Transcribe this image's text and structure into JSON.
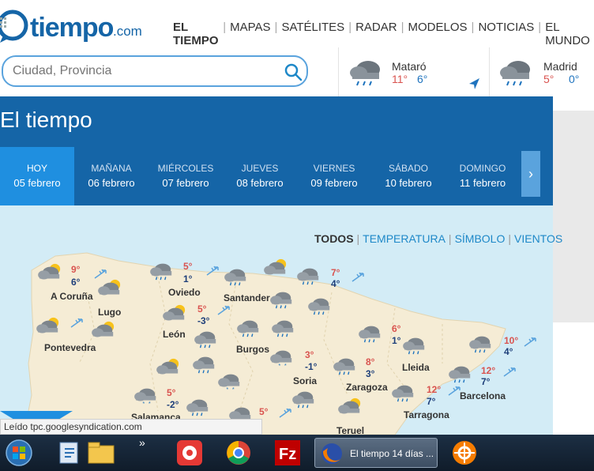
{
  "logo": {
    "brand": "tiempo",
    "domain": ".com"
  },
  "nav": {
    "items": [
      "EL TIEMPO",
      "MAPAS",
      "SATÉLITES",
      "RADAR",
      "MODELOS",
      "NOTICIAS",
      "EL MUNDO"
    ]
  },
  "search": {
    "placeholder": "Ciudad, Provincia"
  },
  "saved_locations": [
    {
      "name": "Mataró",
      "max": "11°",
      "min": "6°",
      "icon": "rain-cloud-icon"
    },
    {
      "name": "Madrid",
      "max": "5°",
      "min": "0°",
      "icon": "rain-cloud-icon"
    }
  ],
  "main": {
    "title": "El tiempo"
  },
  "days": [
    {
      "name": "HOY",
      "date": "05 febrero"
    },
    {
      "name": "MAÑANA",
      "date": "06 febrero"
    },
    {
      "name": "MIÉRCOLES",
      "date": "07 febrero"
    },
    {
      "name": "JUEVES",
      "date": "08 febrero"
    },
    {
      "name": "VIERNES",
      "date": "09 febrero"
    },
    {
      "name": "SÁBADO",
      "date": "10 febrero"
    },
    {
      "name": "DOMINGO",
      "date": "11 febrero"
    }
  ],
  "filters": {
    "all": "TODOS",
    "temperature": "TEMPERATURA",
    "symbol": "SÍMBOLO",
    "winds": "VIENTOS"
  },
  "map_cities": [
    {
      "name": "A Coruña",
      "max": "9°",
      "min": "6°"
    },
    {
      "name": "Lugo",
      "max": "",
      "min": ""
    },
    {
      "name": "Oviedo",
      "max": "5°",
      "min": "1°"
    },
    {
      "name": "Santander",
      "max": "",
      "min": ""
    },
    {
      "name": "León",
      "max": "5°",
      "min": "-3°"
    },
    {
      "name": "Pontevedra",
      "max": "",
      "min": ""
    },
    {
      "name": "Burgos",
      "max": "",
      "min": ""
    },
    {
      "name": "Soria",
      "max": "3°",
      "min": "-1°"
    },
    {
      "name": "Zaragoza",
      "max": "8°",
      "min": "3°"
    },
    {
      "name": "Lleida",
      "max": "6°",
      "min": "1°"
    },
    {
      "name": "Barcelona",
      "max": "12°",
      "min": "7°"
    },
    {
      "name": "Tarragona",
      "max": "12°",
      "min": "7°"
    },
    {
      "name": "Teruel",
      "max": "",
      "min": ""
    },
    {
      "name": "Salamanca",
      "max": "5°",
      "min": "-2°"
    }
  ],
  "map_extra_temps": [
    {
      "max": "7°",
      "min": "4°"
    },
    {
      "max": "10°",
      "min": "4°"
    },
    {
      "max": "5°",
      "min": ""
    }
  ],
  "status_bar": {
    "text": "Leído tpc.googlesyndication.com"
  },
  "taskbar": {
    "firefox_label": "El tiempo 14 días ...",
    "overflow": "»"
  },
  "colors": {
    "brand_blue": "#1565a7",
    "tab_active": "#1f8fe0",
    "max_temp": "#d9534f",
    "min_temp": "#1e73be"
  }
}
